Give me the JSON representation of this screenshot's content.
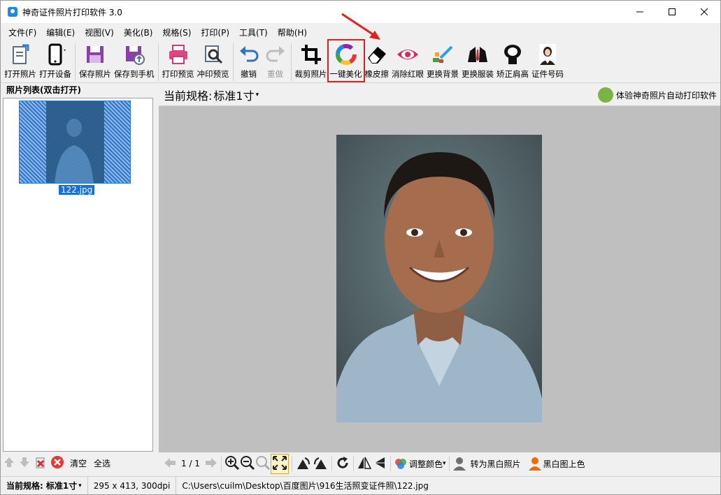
{
  "window": {
    "title": "神奇证件照片打印软件 3.0"
  },
  "menu": [
    "文件(F)",
    "编辑(E)",
    "视图(V)",
    "美化(B)",
    "规格(S)",
    "打印(P)",
    "工具(T)",
    "帮助(H)"
  ],
  "toolbar": {
    "open_photo": "打开照片",
    "open_device": "打开设备",
    "save_photo": "保存照片",
    "save_to_phone": "保存到手机",
    "print_preview": "打印预览",
    "develop_preview": "冲印预览",
    "undo": "撤销",
    "redo": "重做",
    "crop": "裁剪照片",
    "auto_beautify": "一键美化",
    "eraser": "橡皮擦",
    "red_eye": "消除红眼",
    "change_bg": "更换背景",
    "change_outfit": "更换服装",
    "fix_shoulder": "矫正肩高",
    "id_number": "证件号码"
  },
  "left_panel": {
    "title": "照片列表(双击打开)",
    "thumb_label": "122.jpg",
    "clear": "清空",
    "select_all": "全选"
  },
  "main": {
    "spec_label": "当前规格:",
    "spec_value": "标准1寸",
    "promo": "体验神奇照片自动打印软件"
  },
  "bottom": {
    "page": "1 / 1",
    "adjust_color": "调整颜色",
    "to_bw": "转为黑白照片",
    "colorize": "黑白图上色"
  },
  "status": {
    "spec_label": "当前规格:",
    "spec_value": "标准1寸",
    "size": "295 x 413, 300dpi",
    "path": "C:\\Users\\cuilm\\Desktop\\百度图片\\916生活照变证件照\\122.jpg"
  },
  "colors": {
    "accent_red": "#e02020",
    "selection_blue": "#1b6fd1"
  }
}
